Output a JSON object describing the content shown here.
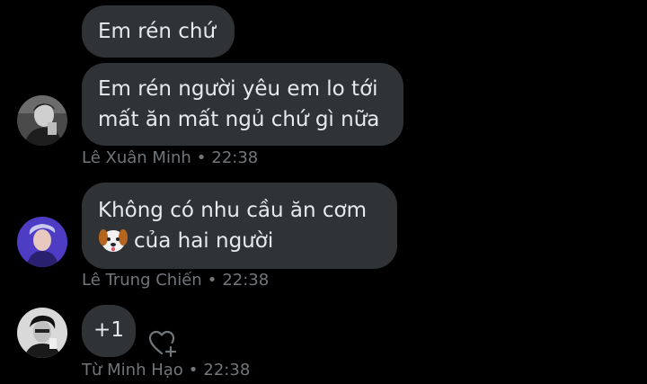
{
  "messages": [
    {
      "id": "m1",
      "lines": [
        "Em rén chứ"
      ]
    },
    {
      "id": "m2",
      "lines": [
        "Em rén người yêu em lo tới",
        "mất ăn mất ngủ chứ gì nữa"
      ],
      "sender": "Lê Xuân Minh",
      "time": "22:38"
    },
    {
      "id": "m3",
      "lines": [
        "Không có nhu cầu ăn cơm",
        "của hai người"
      ],
      "emoji": "dog-face-emoji",
      "sender": "Lê Trung Chiến",
      "time": "22:38"
    },
    {
      "id": "m4",
      "lines": [
        "+1"
      ],
      "sender": "Từ Minh Hạo",
      "time": "22:38",
      "reaction_icon": "add-reaction-heart-icon"
    }
  ],
  "separator": "•",
  "colors": {
    "background": "#000000",
    "bubble": "#2f3336",
    "text": "#e7e9ea",
    "meta": "#71767b"
  }
}
